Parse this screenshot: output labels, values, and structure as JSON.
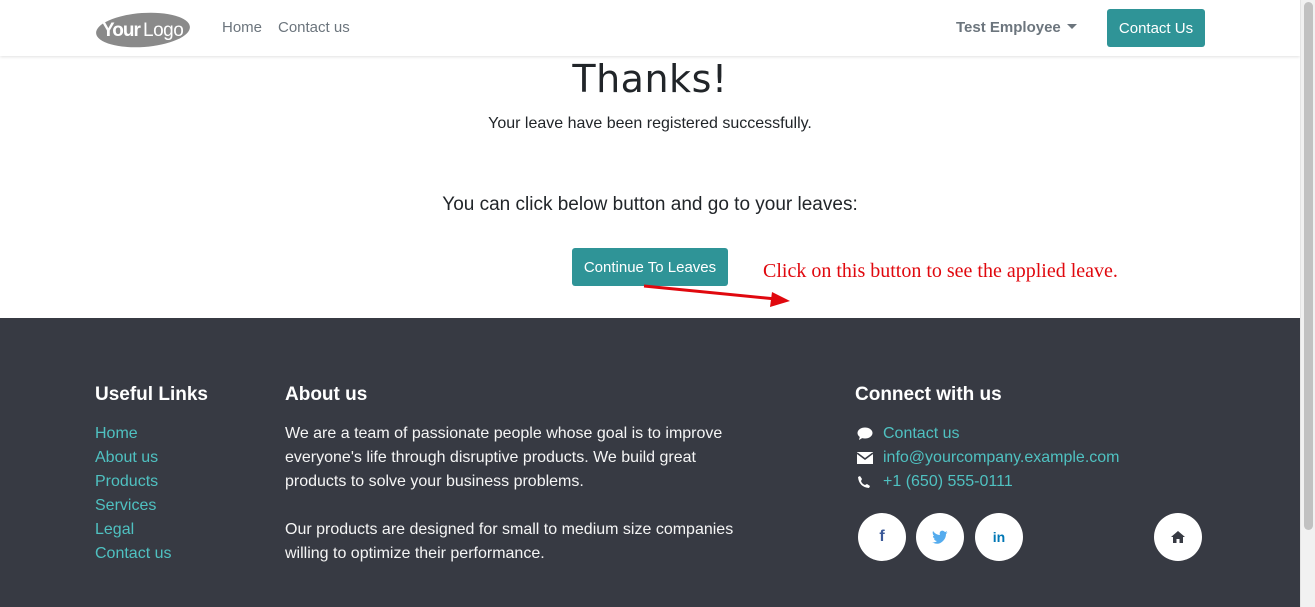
{
  "header": {
    "logo_text": "YourLogo",
    "nav": [
      {
        "label": "Home"
      },
      {
        "label": "Contact us"
      }
    ],
    "user_menu": "Test Employee",
    "contact_button": "Contact Us"
  },
  "main": {
    "title": "Thanks!",
    "message": "Your leave have been registered successfully.",
    "instruction": "You can click below button and go to your leaves:",
    "continue_button": "Continue To Leaves",
    "annotation": "Click on this button to see the applied leave."
  },
  "footer": {
    "useful_links": {
      "heading": "Useful Links",
      "items": [
        "Home",
        "About us",
        "Products",
        "Services",
        "Legal",
        "Contact us"
      ]
    },
    "about": {
      "heading": "About us",
      "paragraph1": "We are a team of passionate people whose goal is to improve everyone's life through disruptive products. We build great products to solve your business problems.",
      "paragraph2": "Our products are designed for small to medium size companies willing to optimize their performance."
    },
    "connect": {
      "heading": "Connect with us",
      "items": [
        {
          "icon": "comment-icon",
          "label": "Contact us"
        },
        {
          "icon": "envelope-icon",
          "label": "info@yourcompany.example.com"
        },
        {
          "icon": "phone-icon",
          "label": "+1 (650) 555-0111"
        }
      ],
      "social": [
        {
          "icon": "facebook-icon",
          "glyph": "f",
          "color": "#3b5998"
        },
        {
          "icon": "twitter-icon",
          "glyph": "t",
          "color": "#55acee"
        },
        {
          "icon": "linkedin-icon",
          "glyph": "in",
          "color": "#0077b5"
        },
        {
          "icon": "home-icon",
          "color": "#373a43"
        }
      ]
    }
  },
  "colors": {
    "accent": "#2f9497",
    "footer_bg": "#373a43",
    "link": "#4fc1c1",
    "annotation": "#e0080e"
  }
}
